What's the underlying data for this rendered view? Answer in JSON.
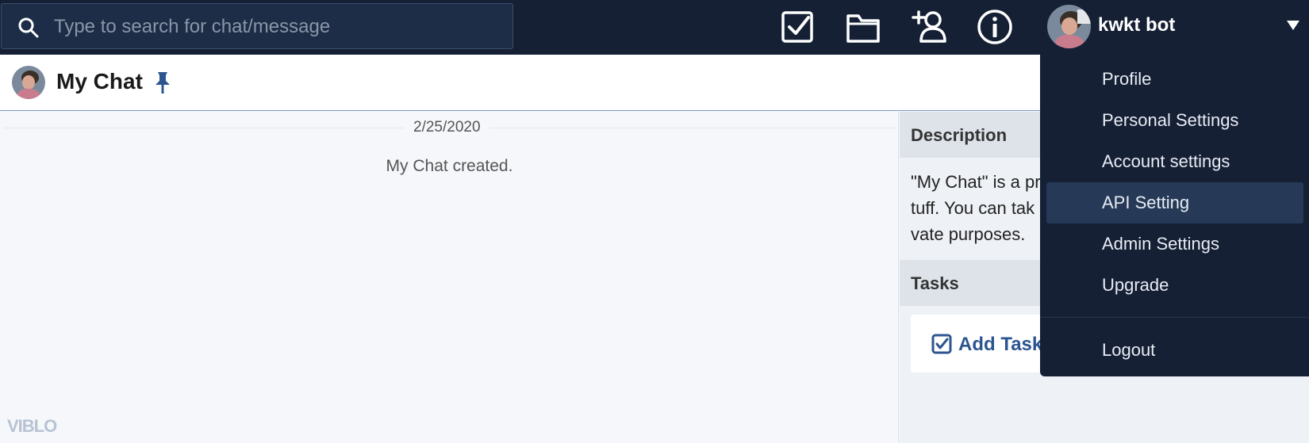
{
  "search": {
    "placeholder": "Type to search for chat/message"
  },
  "toolbar": {
    "icons": [
      "task-checkbox-icon",
      "folder-icon",
      "add-contact-icon",
      "info-icon"
    ]
  },
  "user": {
    "name": "kwkt bot"
  },
  "header": {
    "title": "My Chat"
  },
  "chat": {
    "date": "2/25/2020",
    "system_message": "My Chat created."
  },
  "watermark": "VIBLO",
  "side": {
    "description_title": "Description",
    "description_lines": [
      "\"My Chat\" is a pr",
      "tuff. You can tak",
      "vate purposes."
    ],
    "tasks_title": "Tasks",
    "add_task_label": "Add Task"
  },
  "menu": {
    "items": [
      "Profile",
      "Personal Settings",
      "Account settings",
      "API Setting",
      "Admin Settings",
      "Upgrade"
    ],
    "active": "API Setting",
    "logout": "Logout"
  },
  "colors": {
    "topbar": "#152035",
    "accent": "#2c5590",
    "menu_active": "#263a58"
  }
}
